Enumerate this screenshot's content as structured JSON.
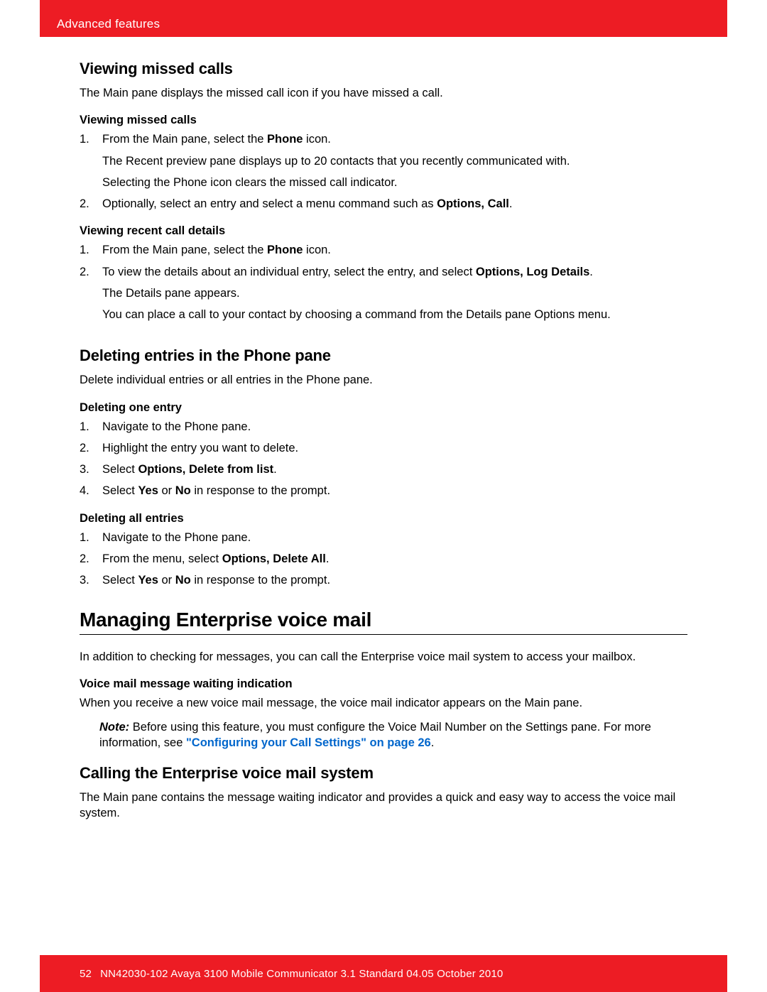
{
  "header": {
    "title": "Advanced features"
  },
  "sections": {
    "viewing_missed_calls": {
      "heading": "Viewing missed calls",
      "intro": "The Main pane displays the missed call icon if you have missed a call.",
      "sub1_heading": "Viewing missed calls",
      "step1_num": "1.",
      "step1_line1a": "From the Main pane, select the ",
      "step1_line1b": "Phone",
      "step1_line1c": " icon.",
      "step1_line2": "The Recent preview pane displays up to 20 contacts that you recently communicated with.",
      "step1_line3": "Selecting the Phone icon clears the missed call indicator.",
      "step2_num": "2.",
      "step2a": "Optionally, select an entry and select a menu command such as ",
      "step2b": "Options, Call",
      "step2c": ".",
      "sub2_heading": "Viewing recent call details",
      "recent_step1_num": "1.",
      "recent_step1a": "From the Main pane, select the ",
      "recent_step1b": "Phone",
      "recent_step1c": " icon.",
      "recent_step2_num": "2.",
      "recent_step2a": "To view the details about an individual entry, select the entry, and select ",
      "recent_step2b": "Options, Log Details",
      "recent_step2c": ".",
      "recent_step2_line2": "The Details pane appears.",
      "recent_step2_line3": "You can place a call to your contact by choosing a command from the Details pane Options menu."
    },
    "deleting_entries": {
      "heading": "Deleting entries in the Phone pane",
      "intro": "Delete individual entries or all entries in the Phone pane.",
      "sub1_heading": "Deleting one entry",
      "d1_num": "1.",
      "d1": "Navigate to the Phone pane.",
      "d2_num": "2.",
      "d2": "Highlight the entry you want to delete.",
      "d3_num": "3.",
      "d3a": "Select ",
      "d3b": "Options, Delete from list",
      "d3c": ".",
      "d4_num": "4.",
      "d4a": "Select ",
      "d4b": "Yes",
      "d4c": " or ",
      "d4d": "No",
      "d4e": " in response to the prompt.",
      "sub2_heading": "Deleting all entries",
      "a1_num": "1.",
      "a1": "Navigate to the Phone pane.",
      "a2_num": "2.",
      "a2a": "From the menu, select ",
      "a2b": "Options, Delete All",
      "a2c": ".",
      "a3_num": "3.",
      "a3a": "Select ",
      "a3b": "Yes",
      "a3c": " or ",
      "a3d": "No",
      "a3e": " in response to the prompt."
    },
    "managing_voicemail": {
      "heading": "Managing Enterprise voice mail",
      "intro": "In addition to checking for messages, you can call the Enterprise voice mail system to access your mailbox.",
      "sub1_heading": "Voice mail message waiting indication",
      "sub1_text": "When you receive a new voice mail message, the voice mail indicator appears on the Main pane.",
      "note_label": "Note:",
      "note_text1": " Before using this feature, you must configure the Voice Mail Number on the Settings pane. For more information, see ",
      "note_link": "\"Configuring your Call Settings\" on page 26",
      "note_text2": "."
    },
    "calling_voicemail": {
      "heading": "Calling the Enterprise voice mail system",
      "intro": "The Main pane contains the message waiting indicator and provides a quick and easy way to access the voice mail system."
    }
  },
  "footer": {
    "page_number": "52",
    "doc_info": "NN42030-102 Avaya 3100 Mobile Communicator 3.1 Standard 04.05 October 2010"
  }
}
